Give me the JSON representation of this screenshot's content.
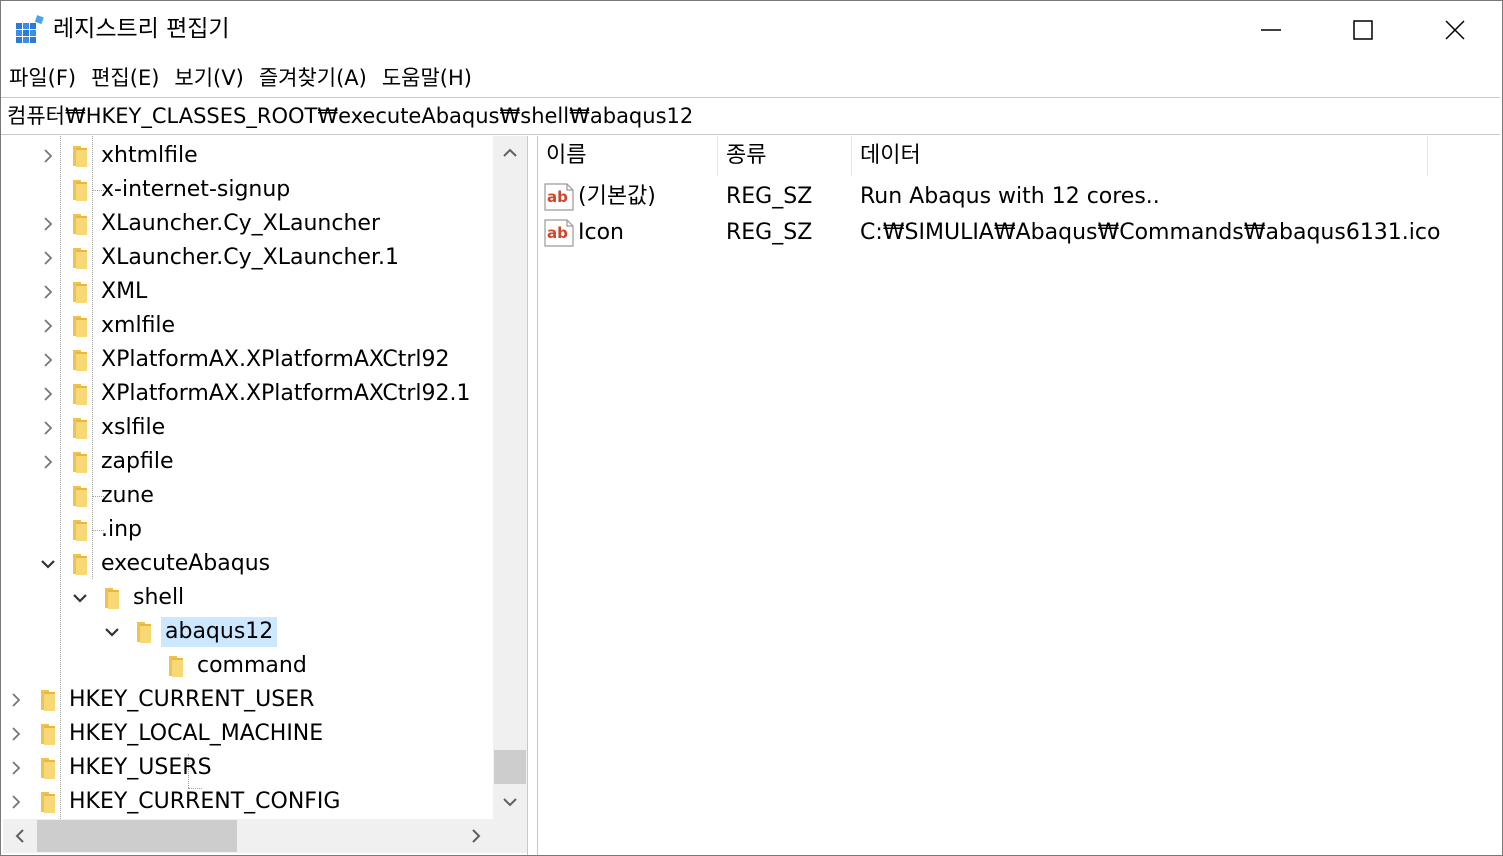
{
  "window": {
    "title": "레지스트리 편집기"
  },
  "menu": [
    "파일(F)",
    "편집(E)",
    "보기(V)",
    "즐겨찾기(A)",
    "도움말(H)"
  ],
  "address": "컴퓨터₩HKEY_CLASSES_ROOT₩executeAbaqus₩shell₩abaqus12",
  "tree": {
    "items": [
      {
        "label": "xhtmlfile",
        "expander": "collapsed"
      },
      {
        "label": "x-internet-signup",
        "expander": "none"
      },
      {
        "label": "XLauncher.Cy_XLauncher",
        "expander": "collapsed"
      },
      {
        "label": "XLauncher.Cy_XLauncher.1",
        "expander": "collapsed"
      },
      {
        "label": "XML",
        "expander": "collapsed"
      },
      {
        "label": "xmlfile",
        "expander": "collapsed"
      },
      {
        "label": "XPlatformAX.XPlatformAXCtrl92",
        "expander": "collapsed"
      },
      {
        "label": "XPlatformAX.XPlatformAXCtrl92.1",
        "expander": "collapsed"
      },
      {
        "label": "xslfile",
        "expander": "collapsed"
      },
      {
        "label": "zapfile",
        "expander": "collapsed"
      },
      {
        "label": "zune",
        "expander": "none"
      },
      {
        "label": ".inp",
        "expander": "none"
      },
      {
        "label": "executeAbaqus",
        "expander": "expanded"
      },
      {
        "label": "shell",
        "expander": "expanded"
      },
      {
        "label": "abaqus12",
        "expander": "expanded",
        "selected": true
      },
      {
        "label": "command",
        "expander": "none"
      },
      {
        "label": "HKEY_CURRENT_USER",
        "expander": "collapsed"
      },
      {
        "label": "HKEY_LOCAL_MACHINE",
        "expander": "collapsed"
      },
      {
        "label": "HKEY_USERS",
        "expander": "collapsed"
      },
      {
        "label": "HKEY_CURRENT_CONFIG",
        "expander": "collapsed"
      }
    ]
  },
  "values": {
    "columns": {
      "name": "이름",
      "type": "종류",
      "data": "데이터"
    },
    "rows": [
      {
        "icon": "string-value-icon",
        "name": "(기본값)",
        "type": "REG_SZ",
        "data": "Run Abaqus with 12 cores.."
      },
      {
        "icon": "string-value-icon",
        "name": "Icon",
        "type": "REG_SZ",
        "data": "C:₩SIMULIA₩Abaqus₩Commands₩abaqus6131.ico"
      }
    ]
  },
  "colors": {
    "selection": "#cce8ff",
    "folder": "#f8d775",
    "ab_icon": "#d0462c"
  }
}
